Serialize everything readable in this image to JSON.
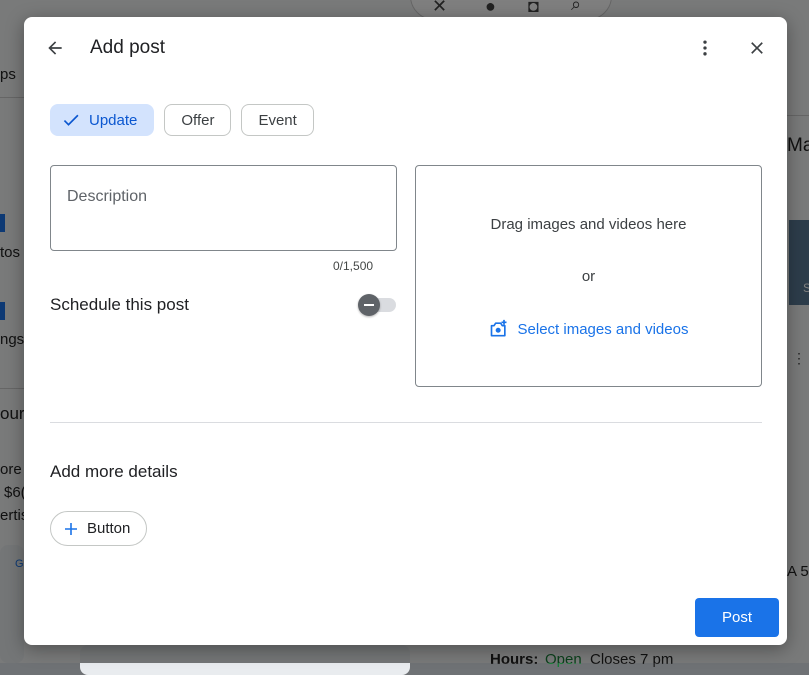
{
  "dialog": {
    "title": "Add post",
    "post_types": [
      {
        "label": "Update",
        "selected": true
      },
      {
        "label": "Offer",
        "selected": false
      },
      {
        "label": "Event",
        "selected": false
      }
    ],
    "description": {
      "placeholder": "Description",
      "value": "",
      "counter": "0/1,500"
    },
    "schedule": {
      "label": "Schedule this post",
      "enabled": false
    },
    "media": {
      "drag_text": "Drag images and videos here",
      "or_text": "or",
      "select_label": "Select images and videos"
    },
    "more_details": {
      "title": "Add more details",
      "button_label": "Button"
    },
    "submit_label": "Post",
    "icons": {
      "back": "arrow-left-icon",
      "menu": "more-vert-icon",
      "close": "close-icon",
      "check": "check-icon",
      "camera": "add-photo-icon",
      "plus": "plus-icon"
    },
    "colors": {
      "accent": "#1a73e8",
      "chip_selected_bg": "#d3e3fd"
    }
  },
  "background": {
    "fragments": [
      "ps",
      "tos",
      "ngs",
      "our",
      "ore",
      "$6(",
      "ertis",
      "G",
      "Ma",
      "S",
      "A 5",
      "Hours:",
      "Open",
      "Closes 7 pm"
    ]
  }
}
